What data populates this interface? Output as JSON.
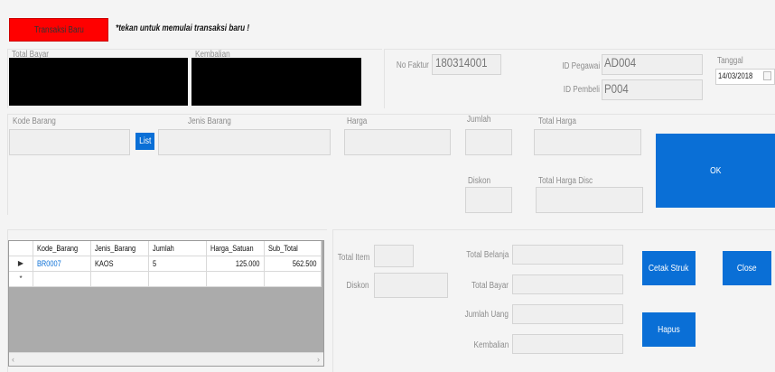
{
  "header": {
    "new_transaction_button": "Transaksi Baru",
    "hint": "*tekan untuk memulai transaksi baru !"
  },
  "summary": {
    "total_bayar_label": "Total Bayar",
    "kembalian_label": "Kembalian"
  },
  "invoice": {
    "no_faktur_label": "No Faktur",
    "no_faktur_value": "180314001",
    "id_pegawai_label": "ID Pegawai",
    "id_pegawai_value": "AD004",
    "id_pembeli_label": "ID Pembeli",
    "id_pembeli_value": "P004",
    "tanggal_label": "Tanggal",
    "tanggal_value": "14/03/2018"
  },
  "item_entry": {
    "kode_barang_label": "Kode Barang",
    "list_button": "List",
    "jenis_barang_label": "Jenis Barang",
    "harga_label": "Harga",
    "jumlah_label": "Jumlah",
    "total_harga_label": "Total Harga",
    "diskon_label": "Diskon",
    "total_harga_disc_label": "Total Harga Disc",
    "ok_button": "OK"
  },
  "grid": {
    "columns": [
      "Kode_Barang",
      "Jenis_Barang",
      "Jumlah",
      "Harga_Satuan",
      "Sub_Total"
    ],
    "rows": [
      [
        "BR0007",
        "KAOS",
        "5",
        "125.000",
        "562.500"
      ]
    ],
    "current_row_marker": "▶",
    "new_row_marker": "*"
  },
  "totals": {
    "total_item_label": "Total Item",
    "diskon_label": "Diskon",
    "total_belanja_label": "Total Belanja",
    "total_bayar_label": "Total Bayar",
    "jumlah_uang_label": "Jumlah Uang",
    "kembalian_label": "Kembalian"
  },
  "actions": {
    "cetak_struk_button": "Cetak Struk",
    "close_button": "Close",
    "hapus_button": "Hapus"
  },
  "colors": {
    "accent_blue": "#0a6fd6",
    "new_button_red": "#ff0000"
  }
}
